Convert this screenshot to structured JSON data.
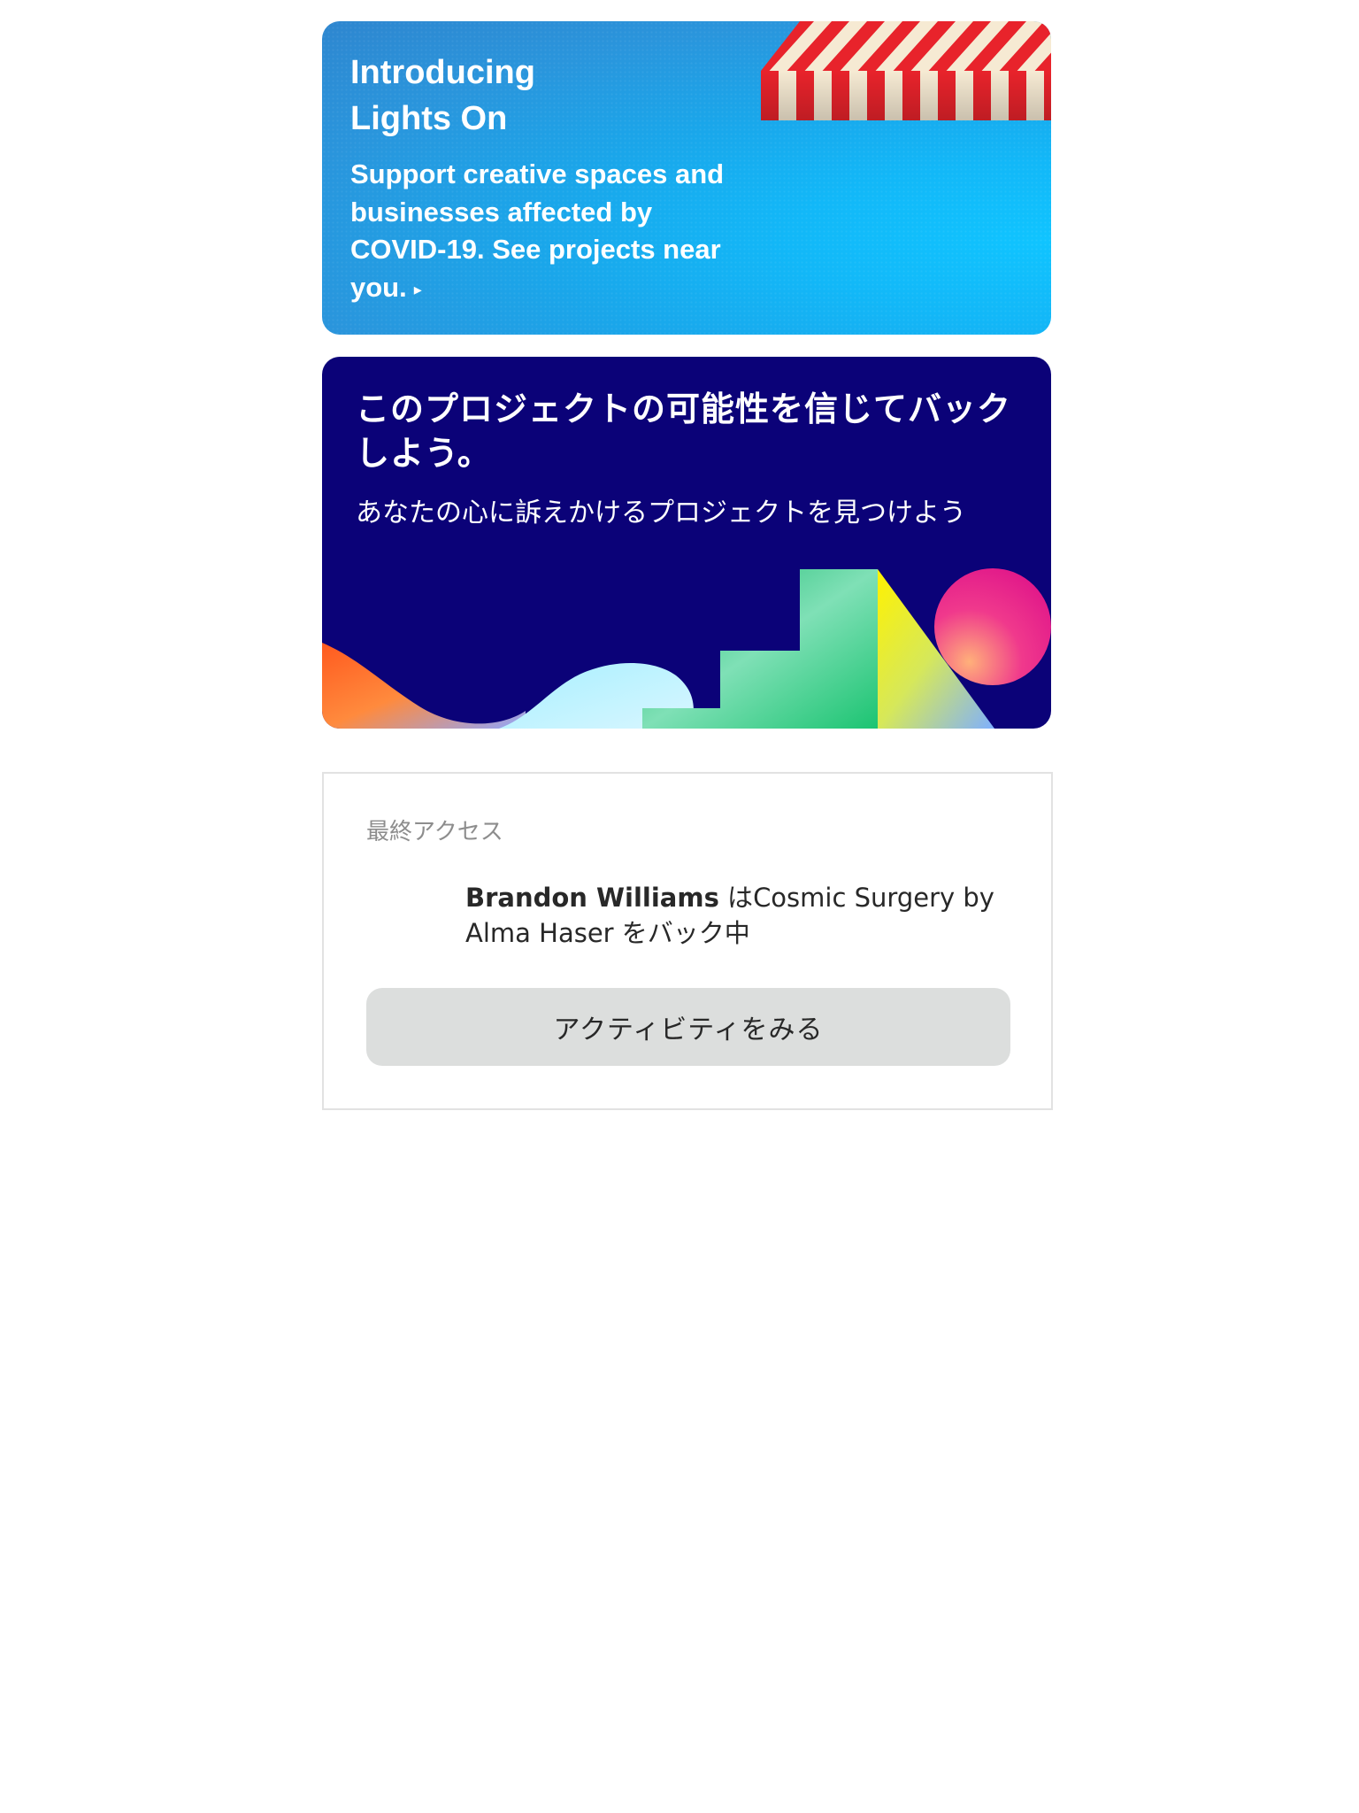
{
  "lights_on_card": {
    "title_line1": "Introducing",
    "title_line2": "Lights On",
    "description": "Support creative spaces and businesses affected by COVID-19. See projects near you.",
    "arrow_glyph": "▸",
    "colors": {
      "background": "#1aa6ea",
      "text": "#ffffff",
      "awning_red": "#e8232b",
      "awning_cream": "#f6ead3"
    }
  },
  "back_project_card": {
    "title": "このプロジェクトの可能性を信じてバックしよう。",
    "subtitle": "あなたの心に訴えかけるプロジェクトを見つけよう",
    "colors": {
      "background": "#0b0278",
      "text": "#ffffff"
    }
  },
  "recent_access": {
    "label": "最終アクセス",
    "backer_name": "Brandon Williams",
    "activity_middle": " は",
    "project_name": "Cosmic Surgery by Alma Haser",
    "activity_suffix": " をバック中",
    "button_label": "アクティビティをみる",
    "colors": {
      "border": "#e2e2e2",
      "button_bg": "#dcdedd",
      "label_text": "#8d8d8d"
    }
  }
}
